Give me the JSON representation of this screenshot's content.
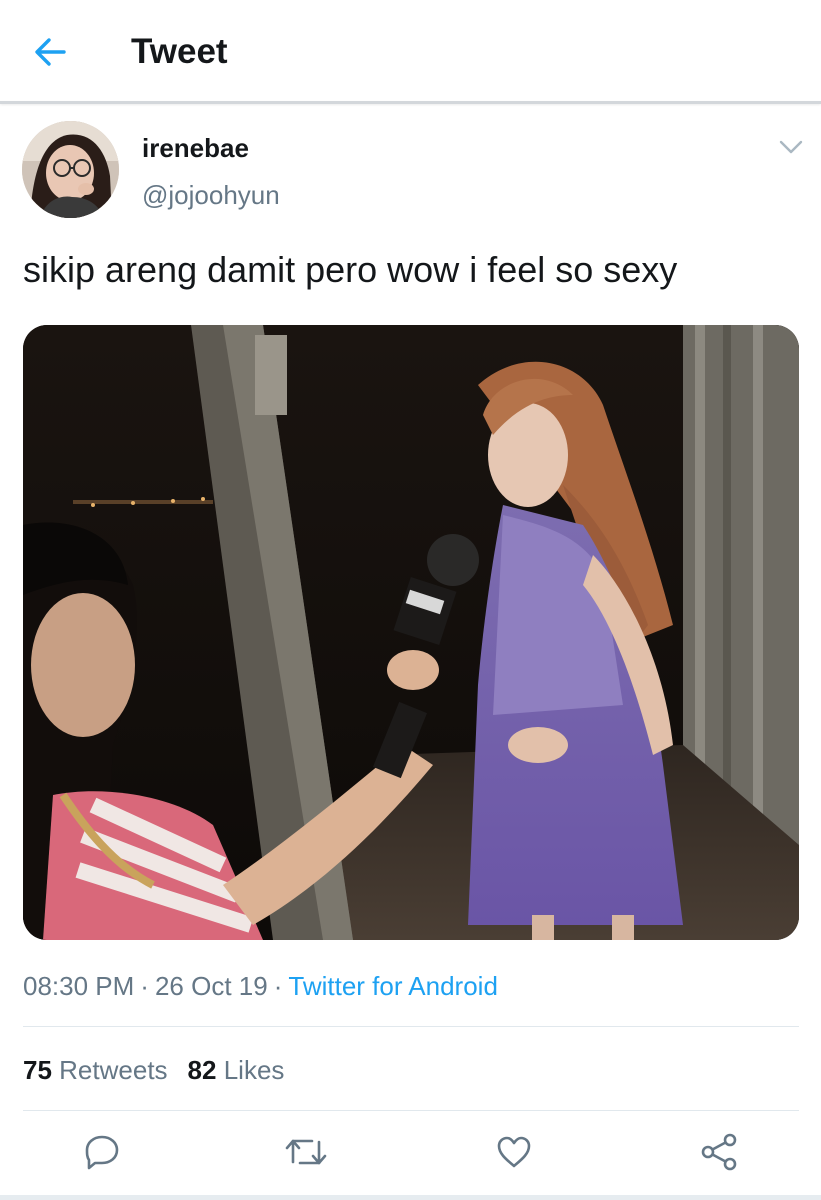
{
  "header": {
    "title": "Tweet",
    "back_icon": "arrow-left-icon"
  },
  "tweet": {
    "author": {
      "display_name": "irenebae",
      "handle": "@jojoohyun"
    },
    "text": "sikip areng damit pero wow i feel so sexy",
    "meta": {
      "time": "08:30 PM",
      "date": "26 Oct 19",
      "separator": "·",
      "source": "Twitter for Android"
    },
    "stats": {
      "retweets_count": "75",
      "retweets_label": "Retweets",
      "likes_count": "82",
      "likes_label": "Likes"
    }
  },
  "actions": [
    {
      "name": "reply",
      "icon": "reply-icon"
    },
    {
      "name": "retweet",
      "icon": "retweet-icon"
    },
    {
      "name": "like",
      "icon": "heart-icon"
    },
    {
      "name": "share",
      "icon": "share-icon"
    }
  ],
  "colors": {
    "accent": "#1da1f2",
    "text_primary": "#14171a",
    "text_secondary": "#657786",
    "divider": "#e1e8ed"
  }
}
